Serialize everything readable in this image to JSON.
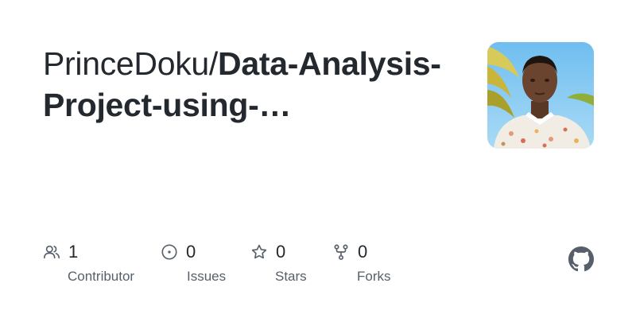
{
  "repo": {
    "owner": "PrinceDoku/",
    "name": "Data-Analysis-Project-using-…"
  },
  "stats": {
    "contributors": {
      "count": "1",
      "label": "Contributor"
    },
    "issues": {
      "count": "0",
      "label": "Issues"
    },
    "stars": {
      "count": "0",
      "label": "Stars"
    },
    "forks": {
      "count": "0",
      "label": "Forks"
    }
  },
  "colors": {
    "text": "#24292f",
    "muted": "#57606a",
    "icon": "#57606a"
  },
  "icons": [
    "people-icon",
    "issue-opened-icon",
    "star-icon",
    "repo-forked-icon",
    "github-mark-icon"
  ]
}
